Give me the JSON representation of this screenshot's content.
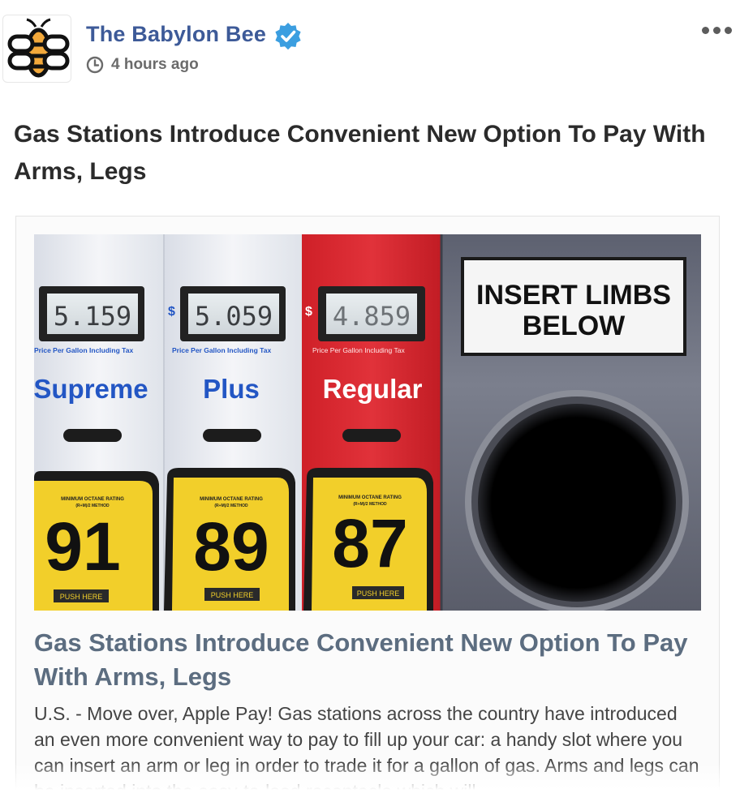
{
  "post": {
    "page_name": "The Babylon Bee",
    "timestamp": "4 hours ago",
    "text": "Gas Stations Introduce Convenient New Option To Pay With Arms, Legs",
    "more_icon": "more-horizontal-icon",
    "verified_icon": "verified-badge-icon",
    "clock_icon": "clock-icon"
  },
  "link_card": {
    "title": "Gas Stations Introduce Convenient New Option To Pay With Arms, Legs",
    "description": "U.S. - Move over, Apple Pay! Gas stations across the country have introduced an even more convenient way to pay to fill up your car: a handy slot where you can insert an arm or leg in order to trade it for a gallon of gas. Arms and legs can be inserted into the easy-to-load receptacle which will"
  },
  "image": {
    "fuels": [
      {
        "price": "5.159",
        "currency": "",
        "caption": "Price Per Gallon Including Tax",
        "grade": "Supreme",
        "octane": "91",
        "rating_label": "MINIMUM OCTANE RATING",
        "method_label": "(R+M)/2 METHOD",
        "push_label": "PUSH HERE"
      },
      {
        "price": "5.059",
        "currency": "$",
        "caption": "Price Per Gallon Including Tax",
        "grade": "Plus",
        "octane": "89",
        "rating_label": "MINIMUM OCTANE RATING",
        "method_label": "(R+M)/2 METHOD",
        "push_label": "PUSH HERE"
      },
      {
        "price": "4.859",
        "currency": "$",
        "caption": "Price Per Gallon Including Tax",
        "grade": "Regular",
        "octane": "87",
        "rating_label": "MINIMUM OCTANE RATING",
        "method_label": "(R+M)/2 METHOD",
        "push_label": "PUSH HERE"
      }
    ],
    "sign_line1": "INSERT LIMBS",
    "sign_line2": "BELOW"
  },
  "colors": {
    "page_name": "#3d5a98",
    "verified": "#3b9ee0",
    "card_title": "#5c6d80",
    "pump_red": "#d8262d",
    "pump_blue": "#2356c4",
    "button_yellow": "#f2cf2a"
  }
}
